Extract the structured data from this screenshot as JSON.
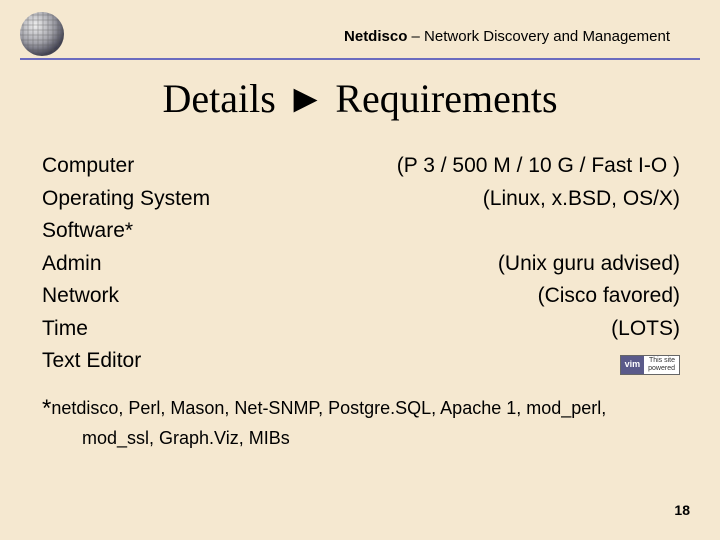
{
  "header": {
    "app_name": "Netdisco",
    "subtitle": " – Network Discovery and Management"
  },
  "title": "Details ► Requirements",
  "rows": {
    "computer": {
      "label": "Computer",
      "value": "(P 3 / 500 M / 10 G / Fast I-O )"
    },
    "os": {
      "label": "Operating System",
      "value": "(Linux, x.BSD, OS/X)"
    },
    "software": {
      "label": "Software*",
      "value": ""
    },
    "admin": {
      "label": "Admin",
      "value": "(Unix guru advised)"
    },
    "network": {
      "label": "Network",
      "value": "(Cisco favored)"
    },
    "time": {
      "label": "Time",
      "value": "(LOTS)"
    },
    "editor": {
      "label": "Text Editor",
      "value": ""
    }
  },
  "vim_badge": {
    "left": "vim",
    "right1": "This site",
    "right2": "powered"
  },
  "footnote": {
    "star": "*",
    "line1": "netdisco, Perl, Mason, Net-SNMP, Postgre.SQL, Apache 1, mod_perl,",
    "line2": "mod_ssl, Graph.Viz, MIBs"
  },
  "page_number": "18"
}
